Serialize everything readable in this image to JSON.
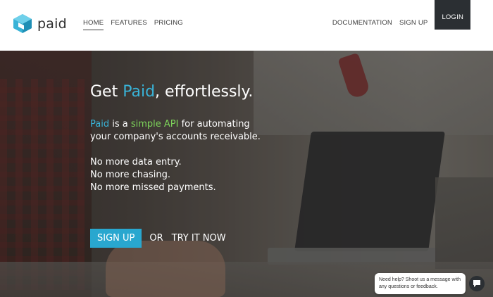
{
  "header": {
    "logo_text": "paid",
    "nav_left": [
      {
        "label": "HOME"
      },
      {
        "label": "FEATURES"
      },
      {
        "label": "PRICING"
      }
    ],
    "nav_right": [
      {
        "label": "DOCUMENTATION"
      },
      {
        "label": "SIGN UP"
      }
    ],
    "login_label": "LOGIN"
  },
  "hero": {
    "title_prefix": "Get ",
    "title_accent": "Paid",
    "title_suffix": ", effortlessly.",
    "sub_brand": "Paid",
    "sub_part1": " is a ",
    "sub_highlight": "simple API",
    "sub_part2": " for automating",
    "sub_line2": "your company's accounts receivable.",
    "list": [
      "No more data entry.",
      "No more chasing.",
      "No more missed payments."
    ],
    "signup_label": "SIGN UP",
    "or_label": "OR",
    "try_label": "TRY IT NOW"
  },
  "chat": {
    "line1": "Need help? Shoot us a message with",
    "line2": "any questions or feedback."
  },
  "colors": {
    "accent": "#39b3d7",
    "highlight": "#7dd35a",
    "login_bg": "#2b2f33",
    "cta_bg": "#29a7cf"
  }
}
